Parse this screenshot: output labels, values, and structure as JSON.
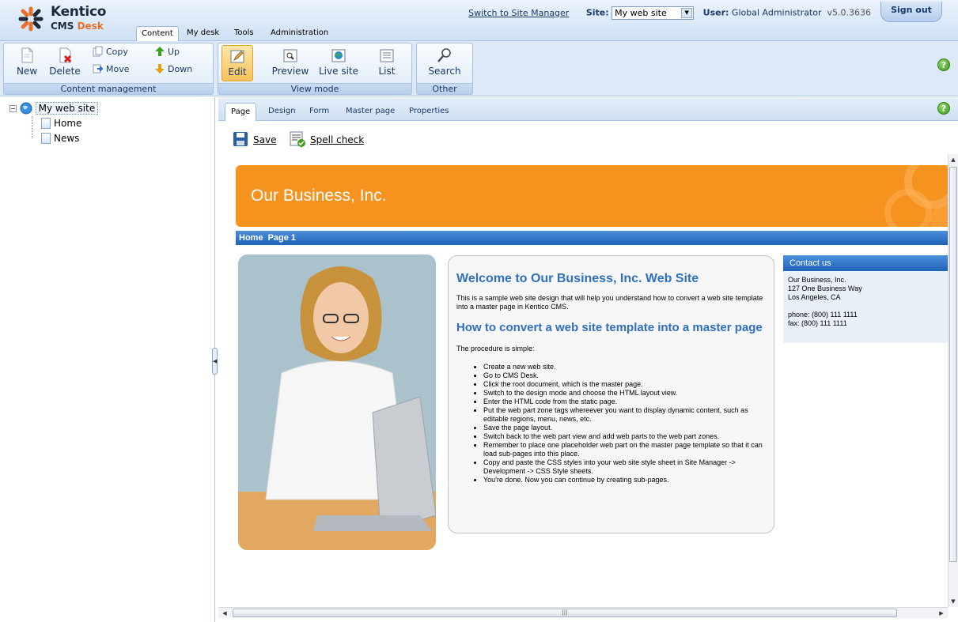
{
  "app": {
    "logo_name": "Kentico",
    "logo_cms": "CMS",
    "logo_desk": "Desk"
  },
  "top_tabs": [
    {
      "label": "Content",
      "active": true
    },
    {
      "label": "My desk",
      "active": false
    },
    {
      "label": "Tools",
      "active": false
    },
    {
      "label": "Administration",
      "active": false
    }
  ],
  "topbar": {
    "switch_link": "Switch to Site Manager",
    "site_label": "Site:",
    "site_value": "My web site",
    "user_label": "User:",
    "user_value": "Global Administrator",
    "version": "v5.0.3636",
    "sign_out": "Sign out"
  },
  "ribbon": {
    "content_management": {
      "caption": "Content management",
      "new": "New",
      "delete": "Delete",
      "copy": "Copy",
      "move": "Move",
      "up": "Up",
      "down": "Down"
    },
    "view_mode": {
      "caption": "View mode",
      "edit": "Edit",
      "preview": "Preview",
      "live_site": "Live site",
      "list": "List"
    },
    "other": {
      "caption": "Other",
      "search": "Search"
    },
    "help": "?"
  },
  "tree": {
    "root": "My web site",
    "children": [
      "Home",
      "News"
    ]
  },
  "page_tabs": [
    "Page",
    "Design",
    "Form",
    "Master page",
    "Properties"
  ],
  "actions": {
    "save": "Save",
    "spell_check": "Spell check"
  },
  "site_preview": {
    "banner_title": "Our Business, Inc.",
    "nav_items": [
      "Home",
      "Page 1"
    ],
    "welcome_heading": "Welcome to Our Business, Inc. Web Site",
    "intro": "This is a sample web site design that will help you understand how to convert a web site template into a master page in Kentico CMS.",
    "howto_heading": "How to convert a web site template into a master page",
    "procedure": "The procedure is simple:",
    "steps": [
      "Create a new web site.",
      "Go to CMS Desk.",
      "Click the root document, which is the master page.",
      "Switch to the design mode and choose the HTML layout view.",
      "Enter the HTML code from the static page.",
      "Put the web part zone tags whereever you want to display dynamic content, such as editable regions, menu, news, etc.",
      "Save the page layout.",
      "Switch back to the web part view and add web parts to the web part zones.",
      "Remember to place one placeholder web part on the master page template so that it can load sub-pages into this place.",
      "Copy and paste the CSS styles into your web site style sheet in Site Manager -> Development -> CSS Style sheets.",
      "You're done. Now you can continue by creating sub-pages."
    ],
    "contact": {
      "heading": "Contact us",
      "company": "Our Business, Inc.",
      "street": "127 One Business Way",
      "city": "Los Angeles, CA",
      "phone": "phone: (800) 111 1111",
      "fax": "fax: (800) 111 1111"
    }
  },
  "colors": {
    "banner_orange": "#f6921e",
    "nav_blue": "#1f63b6",
    "heading_blue": "#2f6fc0"
  }
}
